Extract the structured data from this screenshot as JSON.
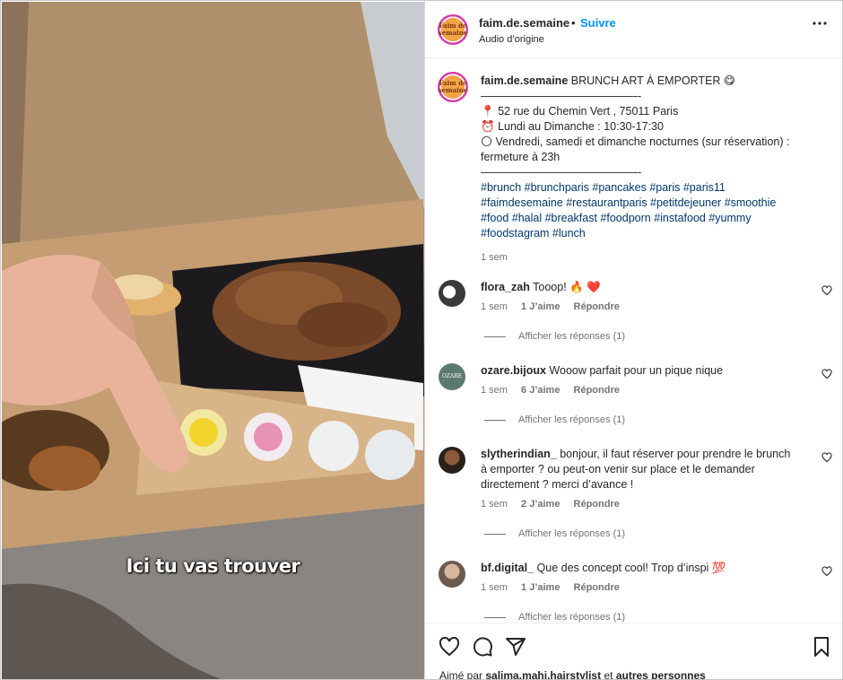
{
  "header": {
    "username": "faim.de.semaine",
    "separator": "•",
    "follow_label": "Suivre",
    "audio": "Audio d’origine",
    "avatar_text": "Faim de semaine"
  },
  "media": {
    "subtitle": "Ici tu vas trouver"
  },
  "caption": {
    "username": "faim.de.semaine",
    "title": "BRUNCH ART À EMPORTER 😋",
    "divider": "——————————————-",
    "address_icon": "📍",
    "address": "52 rue du Chemin Vert , 75011 Paris",
    "hours_icon": "⏰",
    "hours": "Lundi au Dimanche : 10:30-17:30",
    "night_icon": "🌕",
    "night_line1": "Vendredi, samedi et dimanche nocturnes (sur réservation) :",
    "night_line2": "fermeture à 23h",
    "divider2": "——————————————-",
    "tags_line1": "#brunch #brunchparis #pancakes #paris #paris11",
    "tags_line2": "#faimdesemaine #restaurantparis #petitdejeuner #smoothie",
    "tags_line3": "#food #halal #breakfast #foodporn #instafood #yummy",
    "tags_line4": "#foodstagram #lunch",
    "time": "1 sem"
  },
  "comments": [
    {
      "username": "flora_zah",
      "text": "Tooop! 🔥 ❤️",
      "time": "1 sem",
      "likes": "1 J’aime",
      "reply": "Répondre",
      "replies": "Afficher les réponses (1)"
    },
    {
      "username": "ozare.bijoux",
      "text": "Wooow parfait pour un pique nique",
      "time": "1 sem",
      "likes": "6 J’aime",
      "reply": "Répondre",
      "replies": "Afficher les réponses (1)",
      "avatar_text": "OZARE"
    },
    {
      "username": "slytherindian_",
      "text_line1": "bonjour, il faut réserver pour prendre le brunch",
      "text_line2": "à emporter ? ou peut-on venir sur place et le demander",
      "text_line3": "directement ? merci d’avance !",
      "time": "1 sem",
      "likes": "2 J’aime",
      "reply": "Répondre",
      "replies": "Afficher les réponses (1)"
    },
    {
      "username": "bf.digital_",
      "text": "Que des concept cool! Trop d’inspi 💯",
      "time": "1 sem",
      "likes": "1 J’aime",
      "reply": "Répondre",
      "replies": "Afficher les réponses (1)"
    }
  ],
  "footer": {
    "liked_prefix": "Aimé par",
    "liked_user": "salima.mahi.hairstylist",
    "liked_and": "et",
    "liked_others": "autres personnes"
  },
  "icons": [
    "heart-icon",
    "comment-icon",
    "share-icon",
    "bookmark-icon",
    "more-icon"
  ],
  "colors": {
    "follow": "#0095f6",
    "hashtag": "#00376b",
    "meta": "#737373",
    "ring": "#d63aa8"
  }
}
